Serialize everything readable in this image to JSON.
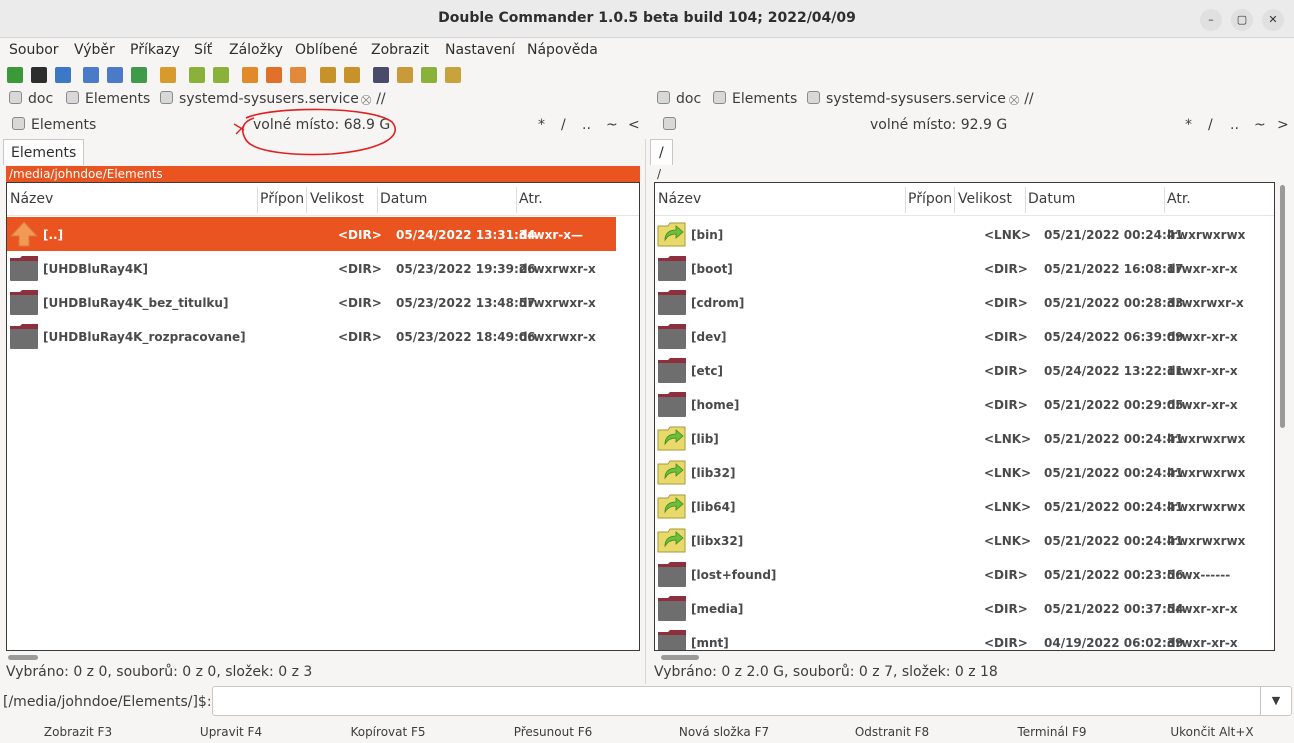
{
  "window": {
    "title": "Double Commander 1.0.5 beta build 104; 2022/04/09",
    "minimize": "–",
    "maximize": "▢",
    "close": "✕"
  },
  "menu": [
    "Soubor",
    "Výběr",
    "Příkazy",
    "Síť",
    "Záložky",
    "Oblíbené",
    "Zobrazit",
    "Nastavení",
    "Nápověda"
  ],
  "toolbar": {
    "icons": [
      "refresh-icon",
      "terminal-icon",
      "settings-icon",
      "brief-view-icon",
      "columns-view-icon",
      "thumbnail-view-icon",
      "compare-icon",
      "copy-left-icon",
      "copy-right-icon",
      "pack-icon",
      "unpack-icon",
      "test-archive-icon",
      "search-icon",
      "multi-rename-icon",
      "binoculars-icon",
      "edit-icon",
      "list-icon",
      "clipboard-icon"
    ],
    "colors": [
      "#3a9a3a",
      "#2d2d2d",
      "#3d78c6",
      "#4a7bc8",
      "#4a7bc8",
      "#3f9a4a",
      "#d89a2a",
      "#8ab23a",
      "#8ab23a",
      "#e08a2a",
      "#e0702a",
      "#e08a3a",
      "#c8922a",
      "#c8922a",
      "#4a4a6a",
      "#c89a3a",
      "#8ab23a",
      "#c8a23a"
    ]
  },
  "left": {
    "drives": [
      "doc",
      "Elements",
      "systemd-sysusers.service",
      "//"
    ],
    "current_dir": "Elements",
    "free_space": "volné místo: 68.9 G",
    "nav": [
      "*",
      "/",
      "..",
      "~",
      "<"
    ],
    "tab": "Elements",
    "path": "/media/johndoe/Elements",
    "columns": [
      "Název",
      "Přípon",
      "Velikost",
      "Datum",
      "Atr."
    ],
    "rows": [
      {
        "name": "[..]",
        "size": "<DIR>",
        "date": "05/24/2022 13:31:34",
        "attr": "drwxr-x—",
        "type": "up"
      },
      {
        "name": "[UHDBluRay4K]",
        "size": "<DIR>",
        "date": "05/23/2022 19:39:26",
        "attr": "drwxrwxr-x",
        "type": "dir"
      },
      {
        "name": "[UHDBluRay4K_bez_titulku]",
        "size": "<DIR>",
        "date": "05/23/2022 13:48:57",
        "attr": "drwxrwxr-x",
        "type": "dir"
      },
      {
        "name": "[UHDBluRay4K_rozpracovane]",
        "size": "<DIR>",
        "date": "05/23/2022 18:49:06",
        "attr": "drwxrwxr-x",
        "type": "dir"
      }
    ],
    "status": "Vybráno: 0 z 0, souborů: 0 z 0, složek: 0 z 3"
  },
  "right": {
    "drives": [
      "doc",
      "Elements",
      "systemd-sysusers.service",
      "//"
    ],
    "current_dir": "",
    "free_space": "volné místo: 92.9 G",
    "nav": [
      "*",
      "/",
      "..",
      "~",
      ">"
    ],
    "tab": "/",
    "path": "/",
    "columns": [
      "Název",
      "Přípon",
      "Velikost",
      "Datum",
      "Atr."
    ],
    "rows": [
      {
        "name": "[bin]",
        "size": "<LNK>",
        "date": "05/21/2022 00:24:41",
        "attr": "lrwxrwxrwx",
        "type": "link"
      },
      {
        "name": "[boot]",
        "size": "<DIR>",
        "date": "05/21/2022 16:08:17",
        "attr": "drwxr-xr-x",
        "type": "dir"
      },
      {
        "name": "[cdrom]",
        "size": "<DIR>",
        "date": "05/21/2022 00:28:33",
        "attr": "drwxrwxr-x",
        "type": "dir"
      },
      {
        "name": "[dev]",
        "size": "<DIR>",
        "date": "05/24/2022 06:39:09",
        "attr": "drwxr-xr-x",
        "type": "dir"
      },
      {
        "name": "[etc]",
        "size": "<DIR>",
        "date": "05/24/2022 13:22:11",
        "attr": "drwxr-xr-x",
        "type": "dir"
      },
      {
        "name": "[home]",
        "size": "<DIR>",
        "date": "05/21/2022 00:29:05",
        "attr": "drwxr-xr-x",
        "type": "dir"
      },
      {
        "name": "[lib]",
        "size": "<LNK>",
        "date": "05/21/2022 00:24:41",
        "attr": "lrwxrwxrwx",
        "type": "link"
      },
      {
        "name": "[lib32]",
        "size": "<LNK>",
        "date": "05/21/2022 00:24:41",
        "attr": "lrwxrwxrwx",
        "type": "link"
      },
      {
        "name": "[lib64]",
        "size": "<LNK>",
        "date": "05/21/2022 00:24:41",
        "attr": "lrwxrwxrwx",
        "type": "link"
      },
      {
        "name": "[libx32]",
        "size": "<LNK>",
        "date": "05/21/2022 00:24:41",
        "attr": "lrwxrwxrwx",
        "type": "link"
      },
      {
        "name": "[lost+found]",
        "size": "<DIR>",
        "date": "05/21/2022 00:23:56",
        "attr": "drwx------",
        "type": "dir"
      },
      {
        "name": "[media]",
        "size": "<DIR>",
        "date": "05/21/2022 00:37:54",
        "attr": "drwxr-xr-x",
        "type": "dir"
      },
      {
        "name": "[mnt]",
        "size": "<DIR>",
        "date": "04/19/2022 06:02:39",
        "attr": "drwxr-xr-x",
        "type": "dir"
      }
    ],
    "status": "Vybráno: 0 z 2.0 G, souborů: 0 z 7, složek: 0 z 18"
  },
  "cmdline": {
    "label": "[/media/johndoe/Elements/]$:",
    "value": ""
  },
  "fkeys": [
    "Zobrazit F3",
    "Upravit F4",
    "Kopírovat F5",
    "Přesunout F6",
    "Nová složka F7",
    "Odstranit F8",
    "Terminál F9",
    "Ukončit Alt+X"
  ],
  "colors": {
    "selection": "#e95420",
    "accent": "#e95420",
    "folder": "#6e6e6e",
    "folder_tab": "#8e2f3e",
    "link": "#e9d96a",
    "annotation": "#e02020"
  }
}
